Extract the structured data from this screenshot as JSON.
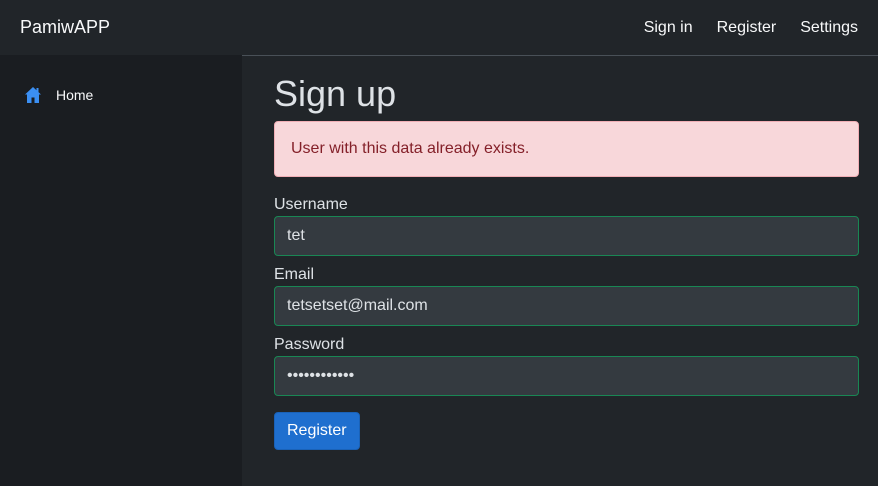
{
  "brand": "PamiwAPP",
  "sidebar": {
    "items": [
      {
        "label": "Home",
        "icon": "home-icon"
      }
    ]
  },
  "topnav": {
    "sign_in": "Sign in",
    "register": "Register",
    "settings": "Settings"
  },
  "page": {
    "title": "Sign up",
    "alert": "User with this data already exists."
  },
  "form": {
    "username_label": "Username",
    "username_value": "tet",
    "email_label": "Email",
    "email_value": "tetsetset@mail.com",
    "password_label": "Password",
    "password_value": "tetsetset123",
    "submit_label": "Register"
  },
  "colors": {
    "accent": "#1f6fcf",
    "valid_border": "#198754",
    "alert_bg": "#f8d7da",
    "alert_text": "#842029"
  }
}
